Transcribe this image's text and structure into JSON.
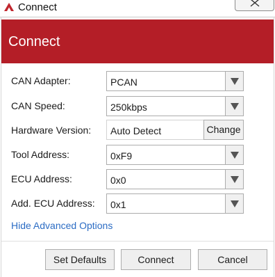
{
  "window": {
    "title": "Connect",
    "accent_color": "#b41e27",
    "icons": {
      "app": "red-triangle-logo-icon",
      "close": "close-icon",
      "dropdown": "chevron-down-icon"
    }
  },
  "header": {
    "title": "Connect"
  },
  "form": {
    "can_adapter": {
      "label": "CAN Adapter:",
      "value": "PCAN"
    },
    "can_speed": {
      "label": "CAN Speed:",
      "value": "250kbps"
    },
    "hardware_version": {
      "label": "Hardware Version:",
      "value": "Auto Detect",
      "button": "Change"
    },
    "tool_address": {
      "label": "Tool Address:",
      "value": "0xF9"
    },
    "ecu_address": {
      "label": "ECU Address:",
      "value": "0x0"
    },
    "add_ecu_address": {
      "label": "Add. ECU Address:",
      "value": "0x1"
    }
  },
  "advanced_link": "Hide Advanced Options",
  "buttons": {
    "set_defaults": "Set Defaults",
    "connect": "Connect",
    "cancel": "Cancel"
  }
}
